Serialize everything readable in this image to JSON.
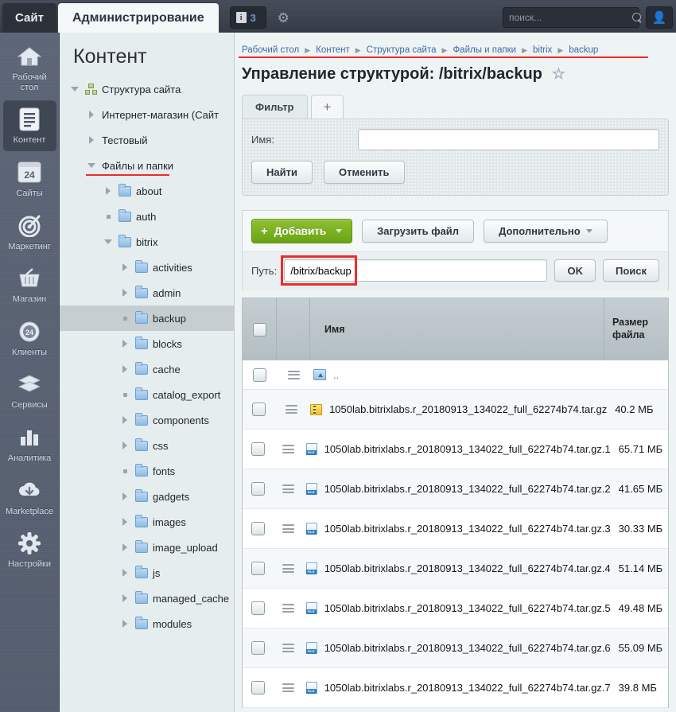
{
  "topbar": {
    "site_tab": "Сайт",
    "admin_tab": "Администрирование",
    "counter_icon": "info-icon",
    "counter_value": "3",
    "gear_icon": "gear-icon",
    "search_placeholder": "поиск...",
    "search_value": "",
    "search_icon": "search-icon",
    "user_icon": "user-icon"
  },
  "rail": {
    "items": [
      {
        "label": "Рабочий стол",
        "icon": "home-icon",
        "active": false
      },
      {
        "label": "Контент",
        "icon": "document-icon",
        "active": true
      },
      {
        "label": "Сайты",
        "icon": "bitrix24-icon",
        "active": false
      },
      {
        "label": "Маркетинг",
        "icon": "target-icon",
        "active": false
      },
      {
        "label": "Магазин",
        "icon": "basket-icon",
        "active": false
      },
      {
        "label": "Клиенты",
        "icon": "crm24-icon",
        "active": false
      },
      {
        "label": "Сервисы",
        "icon": "layers-icon",
        "active": false
      },
      {
        "label": "Аналитика",
        "icon": "bar-chart-icon",
        "active": false
      },
      {
        "label": "Marketplace",
        "icon": "cloud-download-icon",
        "active": false
      },
      {
        "label": "Настройки",
        "icon": "gear-icon",
        "active": false
      }
    ]
  },
  "tree": {
    "title": "Контент",
    "nodes": [
      {
        "label": "Структура сайта",
        "toggle": "down",
        "icon": "sitemap-icon",
        "indent": 0,
        "selected": false,
        "underline": false
      },
      {
        "label": "Интернет-магазин (Сайт",
        "toggle": "right",
        "icon": "none",
        "indent": 1,
        "selected": false,
        "underline": false
      },
      {
        "label": "Тестовый",
        "toggle": "right",
        "icon": "none",
        "indent": 1,
        "selected": false,
        "underline": false
      },
      {
        "label": "Файлы и папки",
        "toggle": "down",
        "icon": "none",
        "indent": 1,
        "selected": false,
        "underline": true
      },
      {
        "label": "about",
        "toggle": "right",
        "icon": "folder-icon",
        "indent": 2,
        "selected": false,
        "underline": false
      },
      {
        "label": "auth",
        "toggle": "dot",
        "icon": "folder-icon",
        "indent": 2,
        "selected": false,
        "underline": false
      },
      {
        "label": "bitrix",
        "toggle": "down",
        "icon": "folder-icon",
        "indent": 2,
        "selected": false,
        "underline": false
      },
      {
        "label": "activities",
        "toggle": "right",
        "icon": "folder-icon",
        "indent": 3,
        "selected": false,
        "underline": false
      },
      {
        "label": "admin",
        "toggle": "right",
        "icon": "folder-icon",
        "indent": 3,
        "selected": false,
        "underline": false
      },
      {
        "label": "backup",
        "toggle": "dot",
        "icon": "folder-icon",
        "indent": 3,
        "selected": true,
        "underline": false
      },
      {
        "label": "blocks",
        "toggle": "right",
        "icon": "folder-icon",
        "indent": 3,
        "selected": false,
        "underline": false
      },
      {
        "label": "cache",
        "toggle": "right",
        "icon": "folder-icon",
        "indent": 3,
        "selected": false,
        "underline": false
      },
      {
        "label": "catalog_export",
        "toggle": "dot",
        "icon": "folder-icon",
        "indent": 3,
        "selected": false,
        "underline": false
      },
      {
        "label": "components",
        "toggle": "right",
        "icon": "folder-icon",
        "indent": 3,
        "selected": false,
        "underline": false
      },
      {
        "label": "css",
        "toggle": "right",
        "icon": "folder-icon",
        "indent": 3,
        "selected": false,
        "underline": false
      },
      {
        "label": "fonts",
        "toggle": "dot",
        "icon": "folder-icon",
        "indent": 3,
        "selected": false,
        "underline": false
      },
      {
        "label": "gadgets",
        "toggle": "right",
        "icon": "folder-icon",
        "indent": 3,
        "selected": false,
        "underline": false
      },
      {
        "label": "images",
        "toggle": "right",
        "icon": "folder-icon",
        "indent": 3,
        "selected": false,
        "underline": false
      },
      {
        "label": "image_upload",
        "toggle": "right",
        "icon": "folder-icon",
        "indent": 3,
        "selected": false,
        "underline": false
      },
      {
        "label": "js",
        "toggle": "right",
        "icon": "folder-icon",
        "indent": 3,
        "selected": false,
        "underline": false
      },
      {
        "label": "managed_cache",
        "toggle": "right",
        "icon": "folder-icon",
        "indent": 3,
        "selected": false,
        "underline": false
      },
      {
        "label": "modules",
        "toggle": "right",
        "icon": "folder-icon",
        "indent": 3,
        "selected": false,
        "underline": false
      }
    ]
  },
  "main": {
    "breadcrumb": [
      "Рабочий стол",
      "Контент",
      "Структура сайта",
      "Файлы и папки",
      "bitrix",
      "backup"
    ],
    "title": "Управление структурой: /bitrix/backup",
    "favorite_icon": "star-icon",
    "filter": {
      "tab_label": "Фильтр",
      "add_tab_label": "+",
      "name_label": "Имя:",
      "name_value": "",
      "find_label": "Найти",
      "cancel_label": "Отменить"
    },
    "toolbar": {
      "add_label": "Добавить",
      "upload_label": "Загрузить файл",
      "more_label": "Дополнительно",
      "path_label": "Путь:",
      "path_value": "/bitrix/backup",
      "ok_label": "OK",
      "search_label": "Поиск"
    },
    "table": {
      "columns": [
        "",
        "",
        "Имя",
        "Размер файла"
      ],
      "rows": [
        {
          "icon": "folder-up-icon",
          "name": "..",
          "size": ""
        },
        {
          "icon": "zip-icon",
          "name": "1050lab.bitrixlabs.r_20180913_134022_full_62274b74.tar.gz",
          "size": "40.2 МБ"
        },
        {
          "icon": "file-icon",
          "name": "1050lab.bitrixlabs.r_20180913_134022_full_62274b74.tar.gz.1",
          "size": "65.71 МБ"
        },
        {
          "icon": "file-icon",
          "name": "1050lab.bitrixlabs.r_20180913_134022_full_62274b74.tar.gz.2",
          "size": "41.65 МБ"
        },
        {
          "icon": "file-icon",
          "name": "1050lab.bitrixlabs.r_20180913_134022_full_62274b74.tar.gz.3",
          "size": "30.33 МБ"
        },
        {
          "icon": "file-icon",
          "name": "1050lab.bitrixlabs.r_20180913_134022_full_62274b74.tar.gz.4",
          "size": "51.14 МБ"
        },
        {
          "icon": "file-icon",
          "name": "1050lab.bitrixlabs.r_20180913_134022_full_62274b74.tar.gz.5",
          "size": "49.48 МБ"
        },
        {
          "icon": "file-icon",
          "name": "1050lab.bitrixlabs.r_20180913_134022_full_62274b74.tar.gz.6",
          "size": "55.09 МБ"
        },
        {
          "icon": "file-icon",
          "name": "1050lab.bitrixlabs.r_20180913_134022_full_62274b74.tar.gz.7",
          "size": "39.8 МБ"
        }
      ]
    }
  },
  "colors": {
    "accent_green": "#7aad1f",
    "annotation_red": "#ef2b2b",
    "link_blue": "#3c6ca5"
  }
}
